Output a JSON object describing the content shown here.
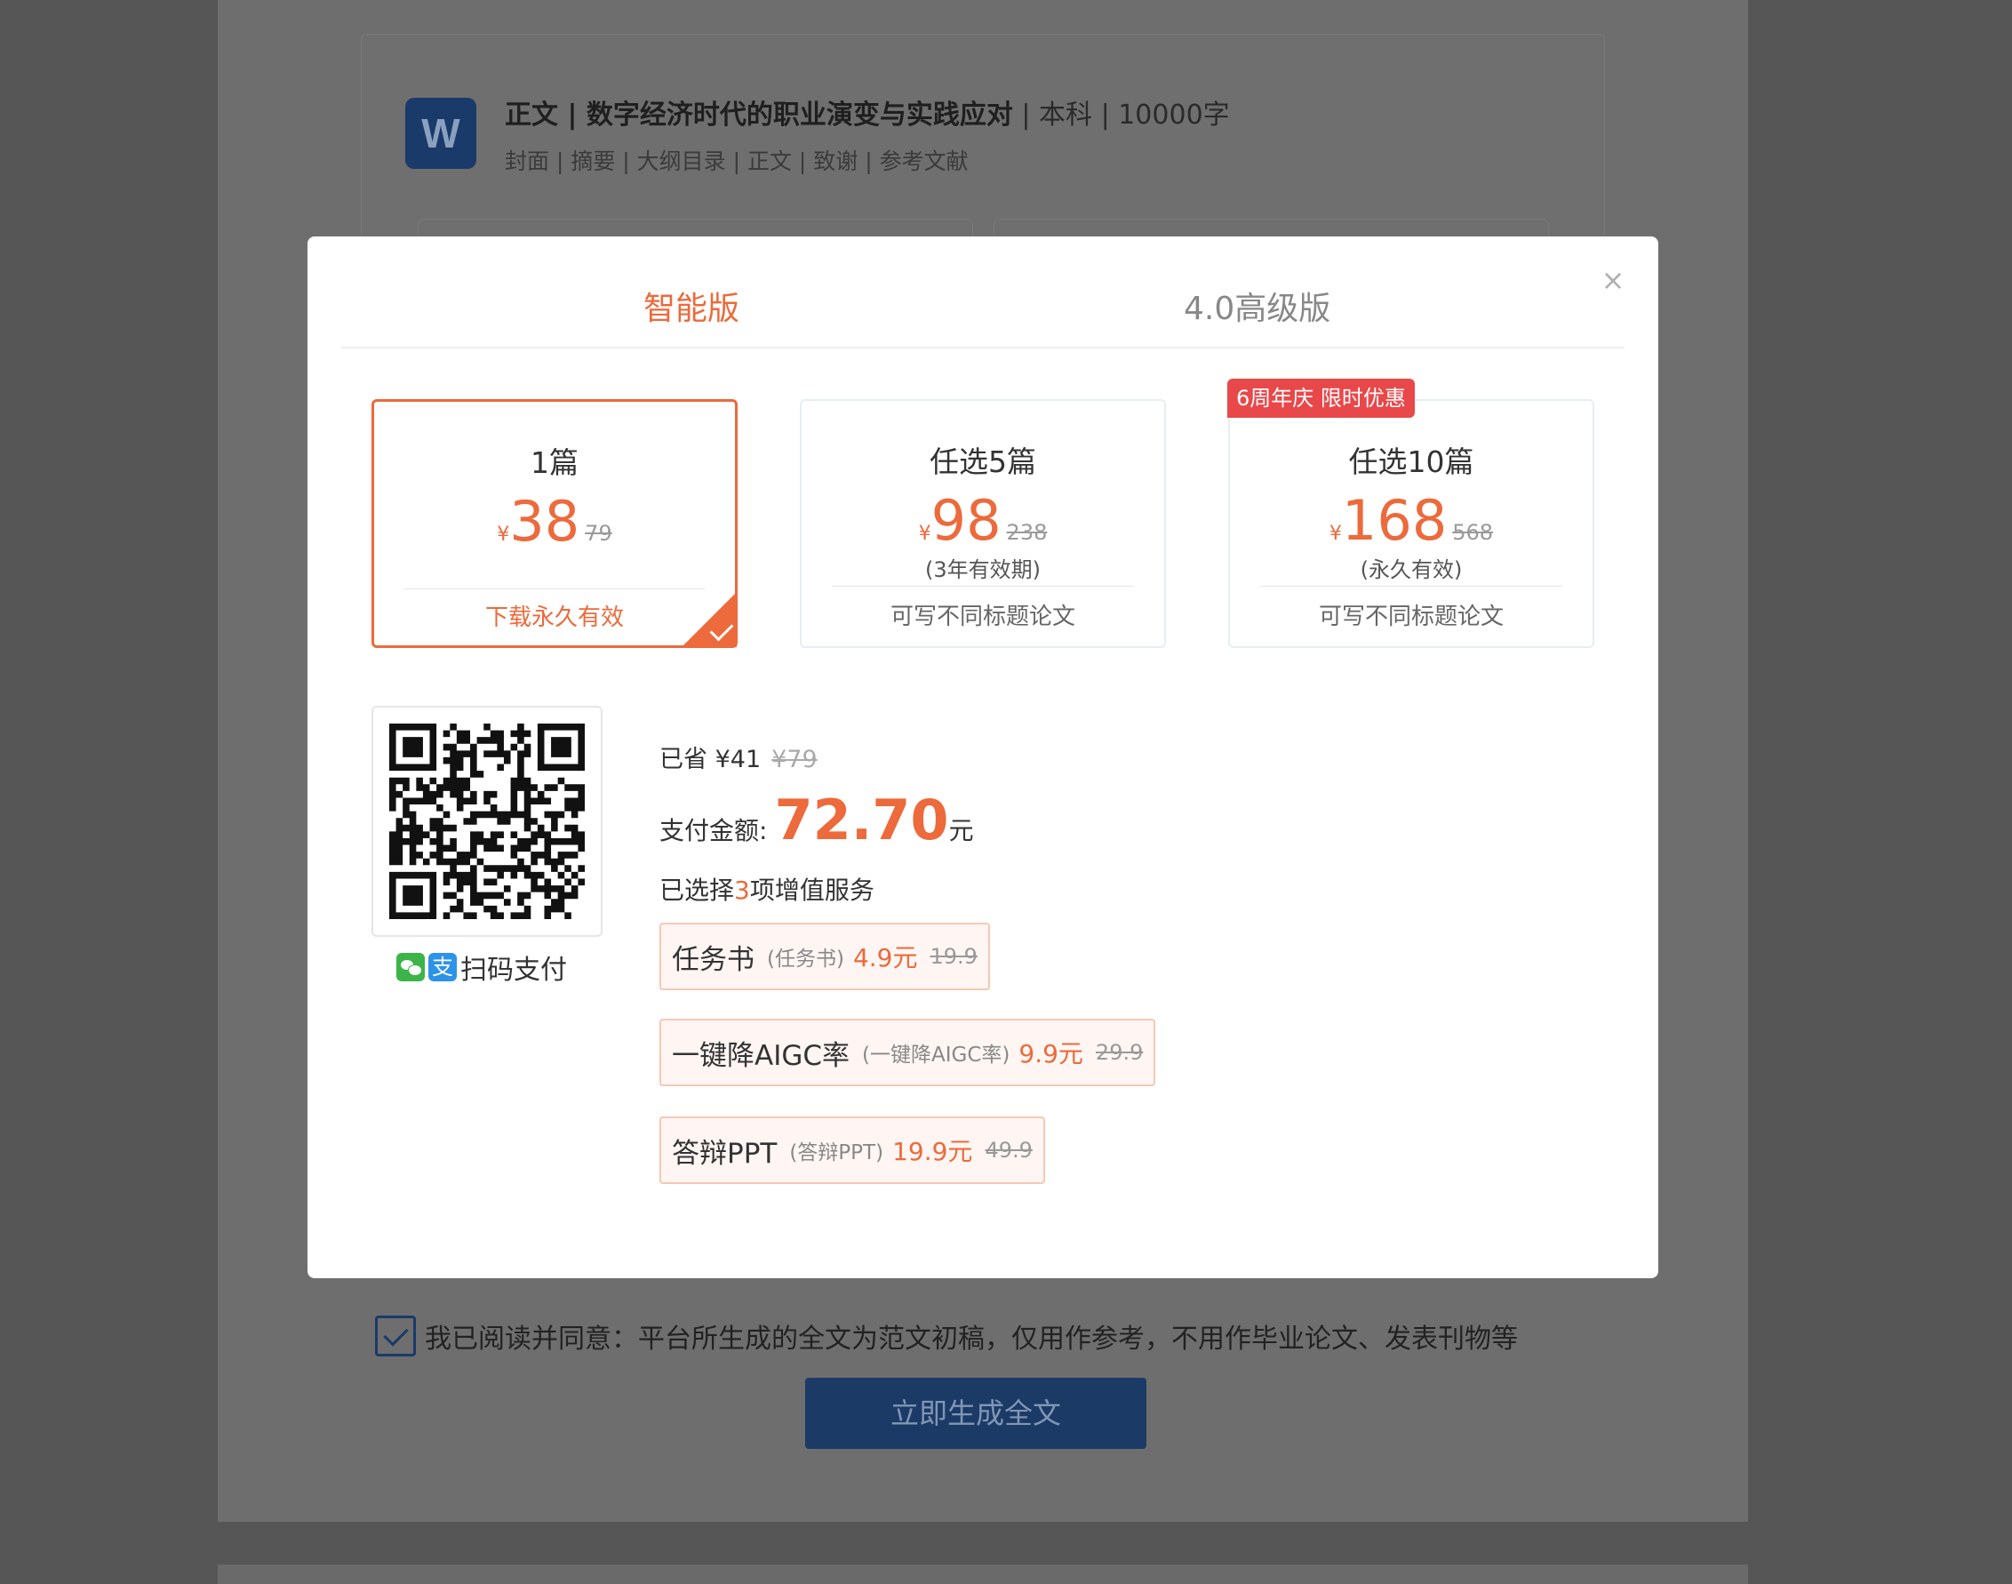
{
  "background": {
    "doc_icon_letter": "W",
    "doc_title": "正文 | 数字经济时代的职业演变与实践应对",
    "doc_meta": " | 本科 | 10000字",
    "doc_sections": "封面 | 摘要 | 大纲目录 | 正文 | 致谢 | 参考文献",
    "agreement_text": "我已阅读并同意：平台所生成的全文为范文初稿，仅用作参考，不用作毕业论文、发表刊物等",
    "generate_button": "立即生成全文"
  },
  "modal": {
    "close_symbol": "×",
    "tabs": [
      {
        "label": "智能版",
        "active": true
      },
      {
        "label": "4.0高级版",
        "active": false
      }
    ],
    "plans": [
      {
        "name": "1篇",
        "currency": "¥",
        "price": "38",
        "original": "79",
        "validity": "",
        "footer": "下载永久有效",
        "selected": true
      },
      {
        "name": "任选5篇",
        "currency": "¥",
        "price": "98",
        "original": "238",
        "validity": "(3年有效期)",
        "footer": "可写不同标题论文",
        "selected": false
      },
      {
        "name": "任选10篇",
        "currency": "¥",
        "price": "168",
        "original": "568",
        "validity": "(永久有效)",
        "footer": "可写不同标题论文",
        "selected": false,
        "badge": "6周年庆 限时优惠"
      }
    ],
    "payment": {
      "method_label": "扫码支付",
      "alipay_glyph": "支",
      "saved_label": "已省 ¥41",
      "saved_original": "¥79",
      "amount_label": "支付金额:",
      "amount_value": "72.70",
      "amount_unit": "元",
      "selected_prefix": "已选择",
      "selected_count": "3",
      "selected_suffix": "项增值服务"
    },
    "services": [
      {
        "name": "任务书",
        "sub": "(任务书)",
        "price": "4.9元",
        "original": "19.9"
      },
      {
        "name": "一键降AIGC率",
        "sub": "(一键降AIGC率)",
        "price": "9.9元",
        "original": "29.9"
      },
      {
        "name": "答辩PPT",
        "sub": "(答辩PPT)",
        "price": "19.9元",
        "original": "49.9"
      }
    ],
    "colors": {
      "accent": "#ec6a3b",
      "badge": "#e8484a",
      "wechat": "#3bb549",
      "alipay": "#2c93e8"
    }
  }
}
